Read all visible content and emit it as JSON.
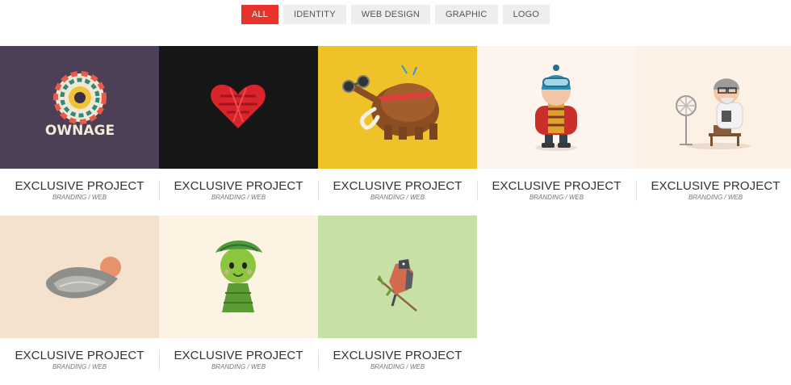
{
  "filters": [
    "ALL",
    "IDENTITY",
    "WEB DESIGN",
    "GRAPHIC",
    "LOGO"
  ],
  "active_filter": "ALL",
  "projects": [
    {
      "title": "EXCLUSIVE PROJECT",
      "category": "BRANDING / WEB",
      "thumb_bg": "#4a3d52",
      "art": "ownage-logo",
      "art_text": "OWNAGE"
    },
    {
      "title": "EXCLUSIVE PROJECT",
      "category": "BRANDING / WEB",
      "thumb_bg": "#161616",
      "art": "red-heart-logo"
    },
    {
      "title": "EXCLUSIVE PROJECT",
      "category": "BRANDING / WEB",
      "thumb_bg": "#f0c22a",
      "art": "mammoth-binoculars"
    },
    {
      "title": "EXCLUSIVE PROJECT",
      "category": "BRANDING / WEB",
      "thumb_bg": "#fdf4ee",
      "art": "winter-boy"
    },
    {
      "title": "EXCLUSIVE PROJECT",
      "category": "BRANDING / WEB",
      "thumb_bg": "#fdf1e6",
      "art": "old-man-fan"
    },
    {
      "title": "EXCLUSIVE PROJECT",
      "category": "BRANDING / WEB",
      "thumb_bg": "#f4e2cf",
      "art": "sun-wave"
    },
    {
      "title": "EXCLUSIVE PROJECT",
      "category": "BRANDING / WEB",
      "thumb_bg": "#fcf3e3",
      "art": "green-leaf-creature"
    },
    {
      "title": "EXCLUSIVE PROJECT",
      "category": "BRANDING / WEB",
      "thumb_bg": "#c6e0a6",
      "art": "bird-on-branch"
    }
  ]
}
